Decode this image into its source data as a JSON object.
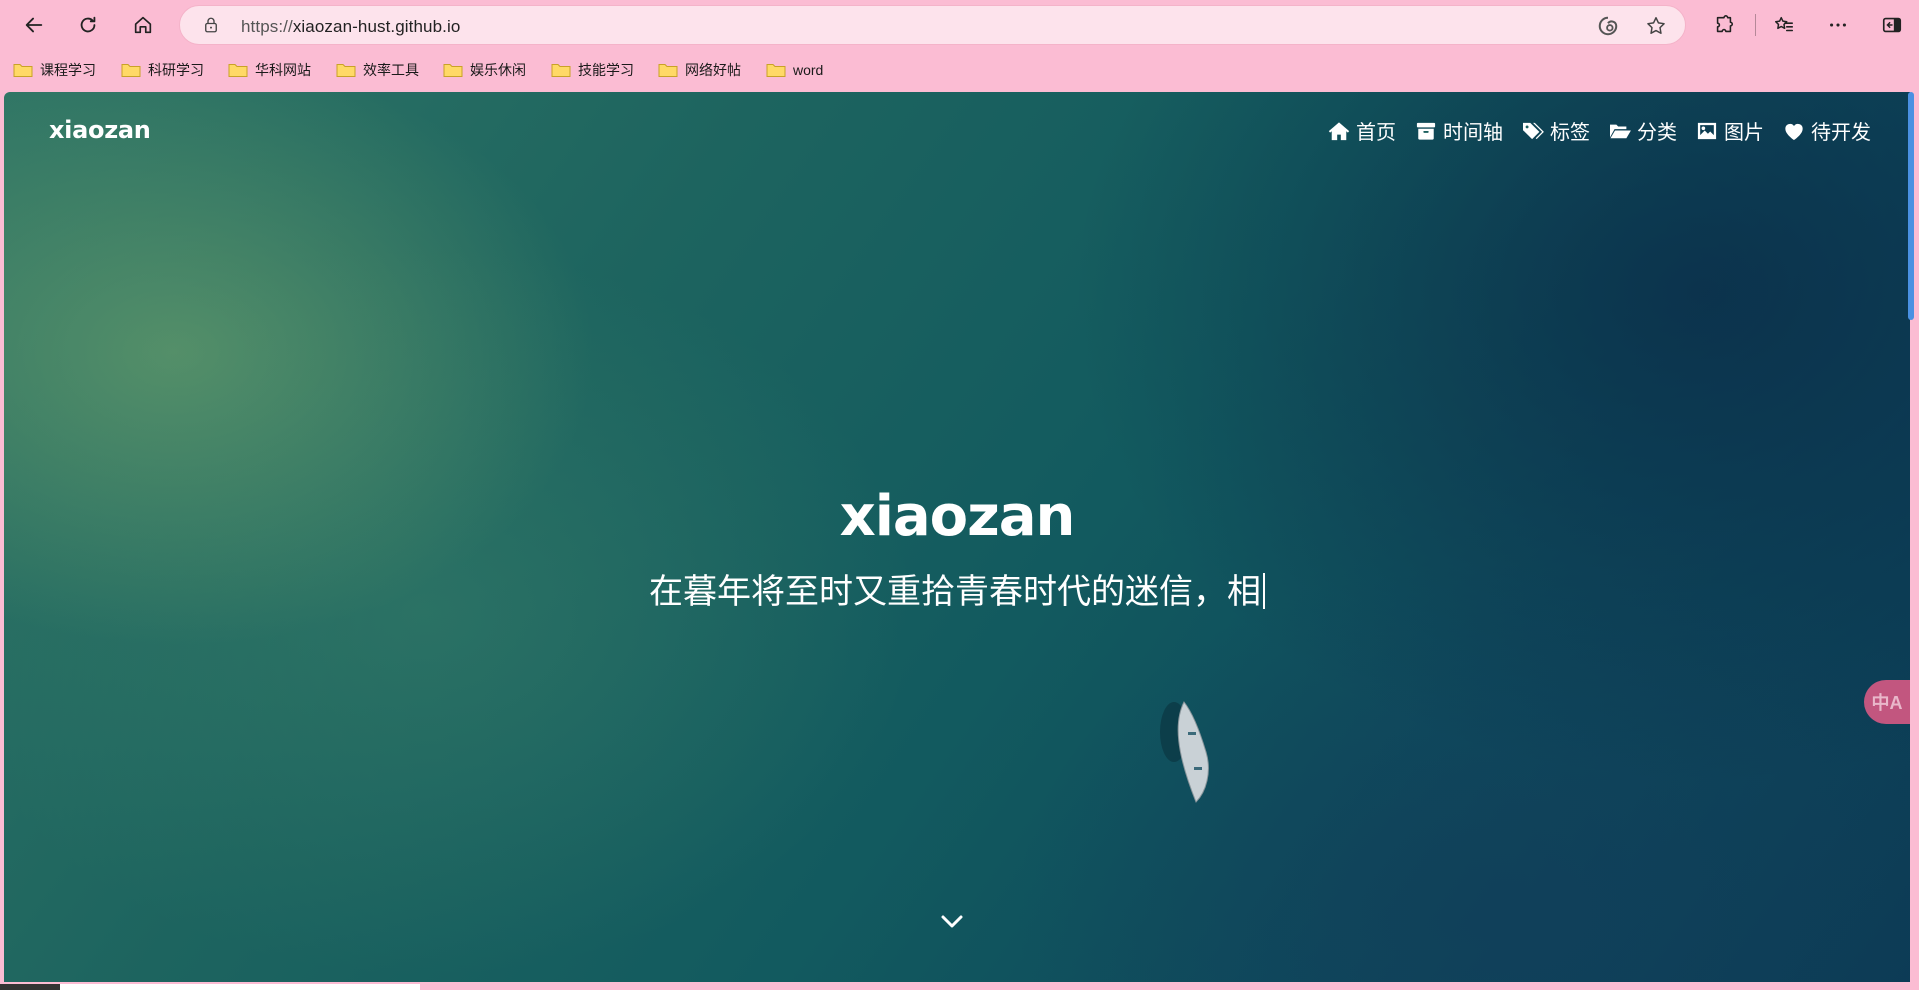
{
  "browser": {
    "url_prefix": "https://",
    "url_host": "xiaozan-hust.github.io",
    "bookmarks": [
      {
        "label": "课程学习"
      },
      {
        "label": "科研学习"
      },
      {
        "label": "华科网站"
      },
      {
        "label": "效率工具"
      },
      {
        "label": "娱乐休闲"
      },
      {
        "label": "技能学习"
      },
      {
        "label": "网络好帖"
      },
      {
        "label": "word"
      }
    ],
    "colors": {
      "chrome": "#fbbcd3",
      "address_bar": "#fde3ec",
      "scrollbar": "#4a90e2"
    }
  },
  "site": {
    "brand": "xiaozan",
    "nav": [
      {
        "label": "首页",
        "icon": "home-icon"
      },
      {
        "label": "时间轴",
        "icon": "archive-icon"
      },
      {
        "label": "标签",
        "icon": "tags-icon"
      },
      {
        "label": "分类",
        "icon": "folder-open-icon"
      },
      {
        "label": "图片",
        "icon": "image-icon"
      },
      {
        "label": "待开发",
        "icon": "heart-icon"
      }
    ],
    "hero_title": "xiaozan",
    "hero_subtitle": "在暮年将至时又重拾青春时代的迷信，相",
    "translate_label": "中A"
  }
}
